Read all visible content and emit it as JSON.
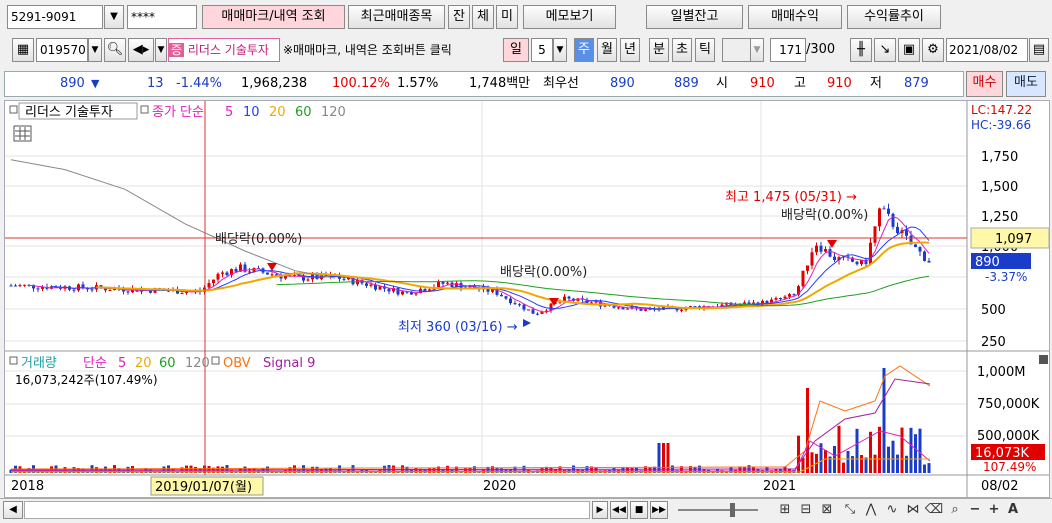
{
  "toolbar1": {
    "account": "5291-9091",
    "password": "****",
    "trade_mark_btn": "매매마크/내역 조회",
    "recent_btn": "최근매매종목",
    "btn_jan": "잔",
    "btn_che": "체",
    "btn_mi": "미",
    "memo_btn": "메모보기",
    "daily_balance_btn": "일별잔고",
    "trade_profit_btn": "매매수익",
    "return_chart_btn": "수익률추이"
  },
  "toolbar2": {
    "code": "019570",
    "stock_badge": "증",
    "stock_name": "리더스 기술투자",
    "hint": "※매매마크, 내역은 조회버튼 클릭",
    "period_label": "일",
    "period_value": "5",
    "periods": [
      "주",
      "월",
      "년",
      "분",
      "초",
      "틱"
    ],
    "count": "171",
    "total": "/300",
    "date": "2021/08/02"
  },
  "quote": {
    "price": "890",
    "arrow": "▼",
    "change": "13",
    "change_pct": "-1.44%",
    "volume": "1,968,238",
    "vol_ratio": "100.12%",
    "turnover": "1.57%",
    "amount": "1,748백만",
    "best_label": "최우선",
    "ask": "890",
    "bid": "889",
    "open_label": "시",
    "open": "910",
    "high_label": "고",
    "high": "910",
    "low_label": "저",
    "low": "879",
    "buy_btn": "매수",
    "sell_btn": "매도"
  },
  "price_panel": {
    "legend_name": "리더스 기술투자",
    "legend_ma_label": "종가 단순",
    "ma_periods": [
      "5",
      "10",
      "20",
      "60",
      "120"
    ],
    "lc": "LC:147.22",
    "hc": "HC:-39.66",
    "y_ticks": [
      "1,750",
      "1,500",
      "1,250",
      "1,000",
      "750",
      "500",
      "250"
    ],
    "cursor_price": "1,097",
    "current_price": "890",
    "current_pct": "-3.37%",
    "annotations": {
      "dividend1": "배당락(0.00%)",
      "dividend2": "배당락(0.00%)",
      "dividend3": "배당락(0.00%)",
      "high": "최고 1,475 (05/31) →",
      "low": "최저 360 (03/16) →"
    }
  },
  "volume_panel": {
    "legend_name": "거래량",
    "legend_ma_label": "단순",
    "ma_periods": [
      "5",
      "20",
      "60",
      "120"
    ],
    "obv": "OBV",
    "signal": "Signal 9",
    "value": "16,073,242주(107.49%)",
    "y_ticks": [
      "1,000M",
      "750,000K",
      "500,000K"
    ],
    "current": "16,073K",
    "current_pct": "107.49%"
  },
  "x_axis": {
    "labels": [
      "2018",
      "2020",
      "2021"
    ],
    "cursor_date": "2019/01/07(월)",
    "last": "08/02"
  },
  "colors": {
    "up": "#e00000",
    "down": "#1a3cc8",
    "ma5": "#e020c0",
    "ma10": "#2040ff",
    "ma20": "#f0a800",
    "ma60": "#20a020",
    "ma120": "#888888",
    "accent": "#5a8fe8"
  },
  "chart_data": {
    "type": "line",
    "title": "",
    "x": [
      "2018",
      "2019/01",
      "2020",
      "2021",
      "2021/05",
      "2021/08"
    ],
    "series": [
      {
        "name": "종가",
        "values": [
          700,
          650,
          520,
          560,
          1200,
          890
        ]
      }
    ],
    "ylim": [
      250,
      1750
    ]
  }
}
